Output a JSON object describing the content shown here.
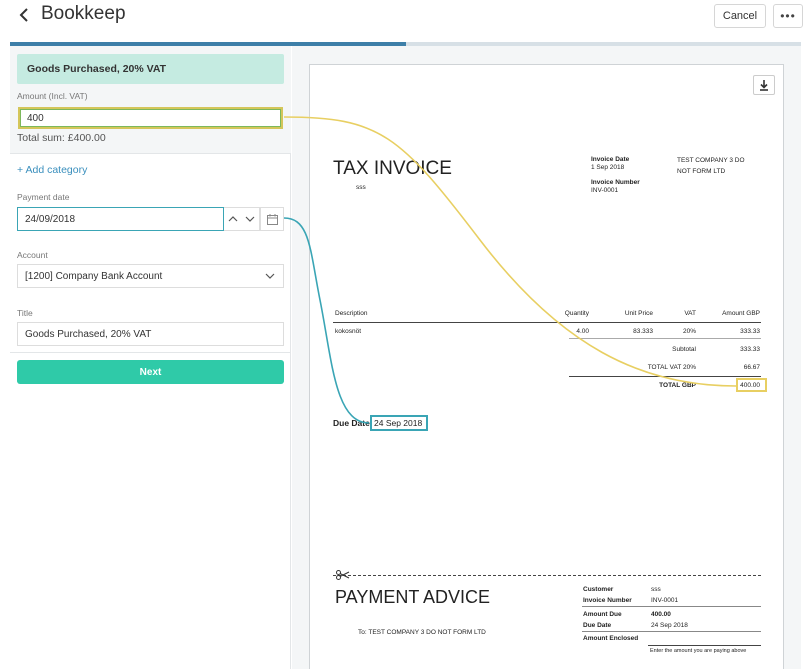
{
  "header": {
    "title": "Bookkeep",
    "cancel_label": "Cancel",
    "more_label": "•••"
  },
  "progress": {
    "fraction": 0.5
  },
  "form": {
    "category_label": "Goods Purchased, 20% VAT",
    "amount_label": "Amount (Incl. VAT)",
    "amount_value": "400",
    "total_sum": "Total sum: £400.00",
    "add_category": "+ Add category",
    "payment_date_label": "Payment date",
    "payment_date_value": "24/09/2018",
    "account_label": "Account",
    "account_value": "[1200] Company Bank Account",
    "title_label": "Title",
    "title_value": "Goods Purchased, 20% VAT",
    "next_label": "Next"
  },
  "invoice": {
    "heading": "TAX INVOICE",
    "customer": "sss",
    "invoice_date_label": "Invoice Date",
    "invoice_date": "1 Sep 2018",
    "invoice_number_label": "Invoice Number",
    "invoice_number": "INV-0001",
    "company_line1": "TEST COMPANY 3 DO",
    "company_line2": "NOT FORM LTD",
    "columns": [
      "Description",
      "Quantity",
      "Unit Price",
      "VAT",
      "Amount GBP"
    ],
    "row": [
      "kokosnöt",
      "4.00",
      "83.333",
      "20%",
      "333.33"
    ],
    "subtotal_label": "Subtotal",
    "subtotal": "333.33",
    "total_vat_label": "TOTAL VAT 20%",
    "total_vat": "66.67",
    "total_label": "TOTAL GBP",
    "total": "400.00",
    "due_date_label": "Due Date",
    "due_date": "24 Sep 2018"
  },
  "payment_advice": {
    "heading": "PAYMENT ADVICE",
    "to": "To:  TEST COMPANY 3 DO NOT FORM LTD",
    "customer_label": "Customer",
    "customer": "sss",
    "invoice_number_label": "Invoice Number",
    "invoice_number": "INV-0001",
    "amount_due_label": "Amount Due",
    "amount_due": "400.00",
    "due_date_label": "Due Date",
    "due_date": "24 Sep 2018",
    "amount_enclosed_label": "Amount Enclosed",
    "enclosed_hint": "Enter the amount you are paying above"
  },
  "colors": {
    "accent_teal": "#2fcaa8",
    "link_blue": "#3a8fbd",
    "highlight_yellow": "#e8cf62",
    "highlight_teal": "#3aa5b5",
    "category_bg": "#c5ebe1"
  },
  "icons": {
    "back": "chevron-left-icon",
    "download": "download-icon",
    "calendar": "calendar-icon",
    "select": "chevron-down-icon",
    "scissors": "scissors-icon"
  }
}
